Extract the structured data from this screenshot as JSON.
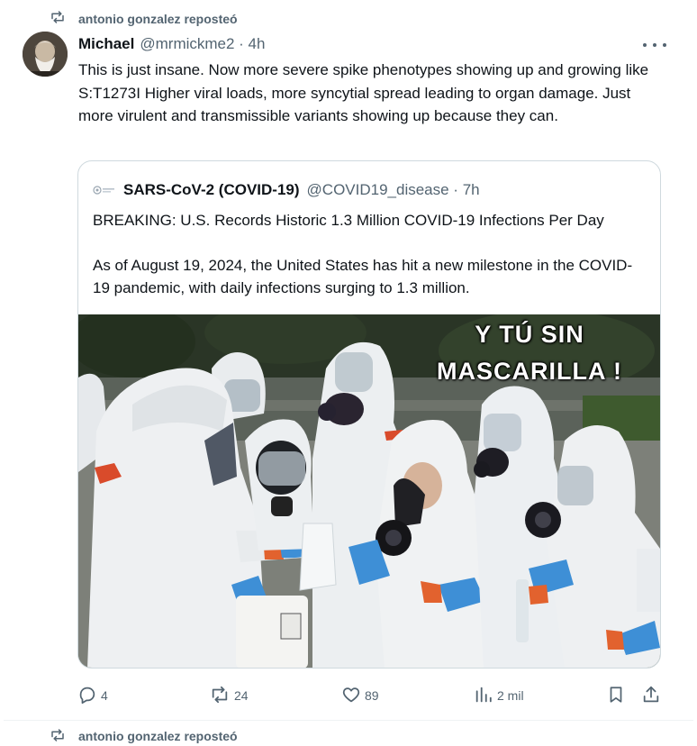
{
  "post": {
    "repost_label": "antonio gonzalez reposteó",
    "author": {
      "name": "Michael",
      "handle_time": "@mrmickme2 · 4h"
    },
    "text": "This is just insane. Now more severe spike phenotypes showing up and growing like S:T1273I Higher viral loads, more syncytial spread leading to organ damage. Just more virulent and transmissible variants showing up because they can.",
    "quote": {
      "name": "SARS-CoV-2 (COVID-19)",
      "handle_time": "@COVID19_disease · 7h",
      "paragraph1": "BREAKING: U.S. Records Historic 1.3 Million COVID-19 Infections Per Day",
      "paragraph2": "As of August 19, 2024, the United States has hit a new milestone in the COVID-19 pandemic, with daily infections surging to 1.3 million.",
      "image_caption_line1": "Y TÚ SIN",
      "image_caption_line2": "MASCARILLA !"
    },
    "actions": {
      "replies": "4",
      "reposts": "24",
      "likes": "89",
      "views": "2 mil"
    }
  },
  "next_post": {
    "repost_label": "antonio gonzalez reposteó"
  },
  "icons": {
    "repost": "repost-icon",
    "more": "more-icon",
    "reply": "reply-icon",
    "like": "heart-icon",
    "views": "views-icon",
    "bookmark": "bookmark-icon",
    "share": "share-icon"
  },
  "colors": {
    "text_primary": "#0f1419",
    "text_secondary": "#536471",
    "border": "#cfd9de",
    "repost_active": "#00ba7c"
  }
}
